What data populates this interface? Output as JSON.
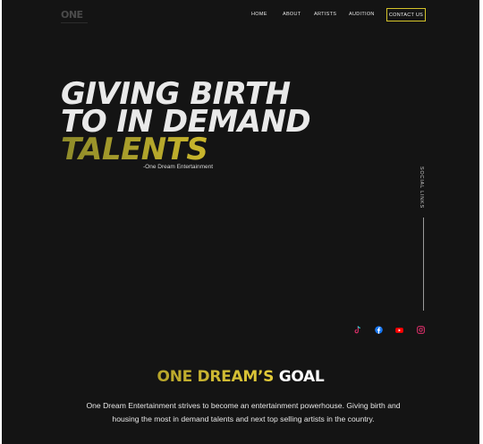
{
  "brand": {
    "logo_text": "ONE"
  },
  "nav": {
    "home": "HOME",
    "about": "ABOUT",
    "artists": "ARTISTS",
    "audition": "AUDITION",
    "contact": "CONTACT US"
  },
  "hero": {
    "line1": "GIVING BIRTH",
    "line2": "TO IN DEMAND",
    "line3": "TALENTS",
    "tagline": "-One Dream Entertainment"
  },
  "social": {
    "label": "SOCIAL LINKS",
    "icons": [
      "tiktok-icon",
      "facebook-icon",
      "youtube-icon",
      "instagram-icon"
    ]
  },
  "goal": {
    "title_gold": "ONE DREAM’S",
    "title_white": "GOAL",
    "text": "One Dream Entertainment strives to become an entertainment powerhouse. Giving birth and housing the most in demand talents and next top selling artists in the country."
  },
  "colors": {
    "background": "#141414",
    "accent_gold": "#d4c32a",
    "text_light": "#e9e9e9",
    "facebook_blue": "#1877f2",
    "youtube_red": "#ff0000",
    "instagram_pink": "#e1306c"
  }
}
